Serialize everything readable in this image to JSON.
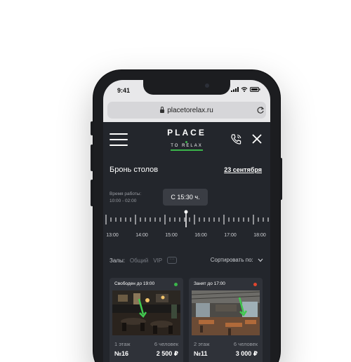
{
  "status_bar": {
    "time": "9:41"
  },
  "browser": {
    "url": "placetorelax.ru"
  },
  "logo": {
    "line1": "PLACE",
    "line2": "TO RELAX"
  },
  "booking": {
    "title": "Бронь столов",
    "date": "23 сентября",
    "hours_label": "Время работы:",
    "hours_value": "10:00 - 02:00",
    "selected_time": "С 15:30 ч."
  },
  "timeline": {
    "labels": [
      "13:00",
      "14:00",
      "15:00",
      "16:00",
      "17:00",
      "18:00"
    ]
  },
  "halls": {
    "label": "Залы:",
    "options": [
      "Общий",
      "VIP"
    ],
    "more": "···",
    "sort_label": "Сортировать по:"
  },
  "cards": [
    {
      "status": "Свободен до 19:00",
      "status_color": "#3bb54a",
      "floor": "1 этаж",
      "people": "6 человек",
      "number": "№16",
      "price": "2 500 ₽"
    },
    {
      "status": "Занят до 17:00",
      "status_color": "#e0452e",
      "floor": "2 этаж",
      "people": "6 человек",
      "number": "№11",
      "price": "3 000 ₽"
    }
  ],
  "icons": [
    "menu-icon",
    "phone-call-icon",
    "close-icon",
    "lock-icon",
    "reload-icon",
    "chevron-down-icon",
    "signal-icon",
    "wifi-icon",
    "battery-icon"
  ]
}
